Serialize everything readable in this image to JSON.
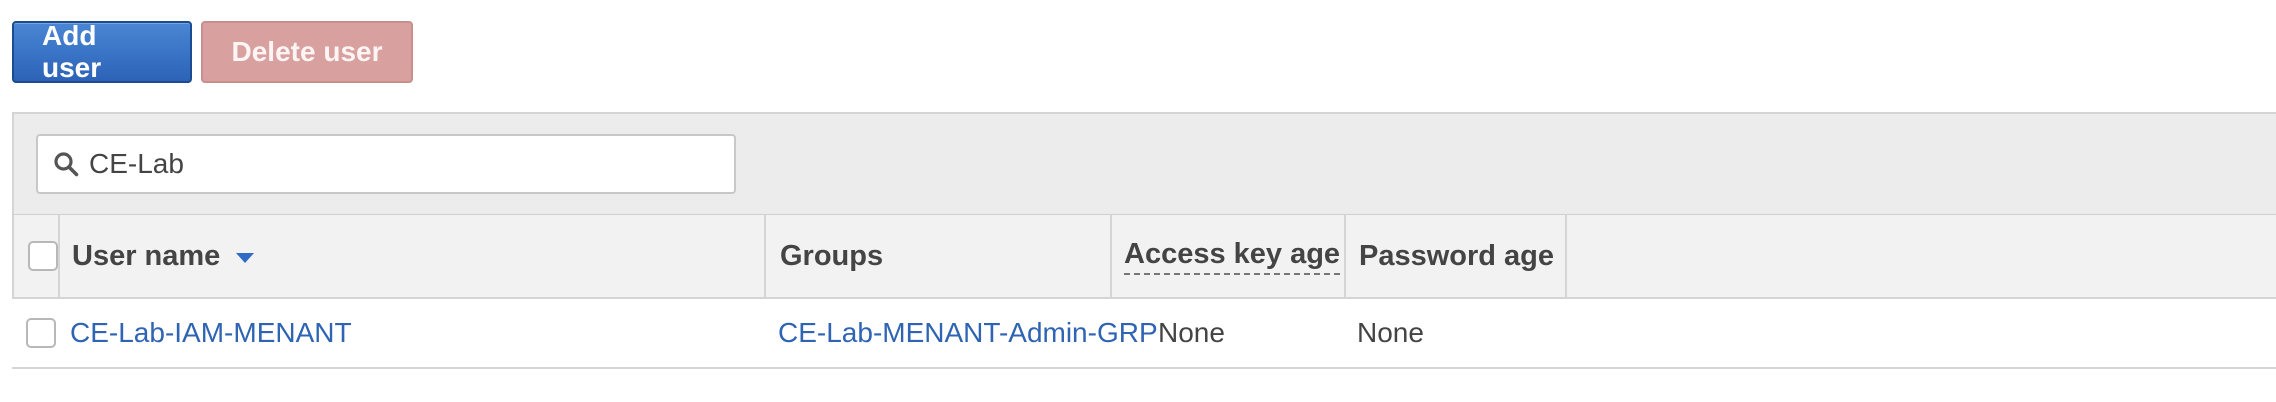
{
  "toolbar": {
    "add_user_label": "Add user",
    "delete_user_label": "Delete user"
  },
  "search": {
    "icon": "search-icon",
    "value": "CE-Lab"
  },
  "table": {
    "columns": [
      {
        "key": "user_name",
        "label": "User name",
        "sorted": "descending"
      },
      {
        "key": "groups",
        "label": "Groups"
      },
      {
        "key": "access_key_age",
        "label": "Access key age"
      },
      {
        "key": "password_age",
        "label": "Password age"
      }
    ],
    "rows": [
      {
        "user_name": "CE-Lab-IAM-MENANT",
        "groups": "CE-Lab-MENANT-Admin-GRP",
        "access_key_age": "None",
        "password_age": "None"
      }
    ]
  },
  "colors": {
    "primary_button": "#2c63b8",
    "danger_button_disabled": "#d9a0a0",
    "link": "#2e64b3",
    "header_background": "#f2f2f2",
    "filter_background": "#ececec"
  }
}
